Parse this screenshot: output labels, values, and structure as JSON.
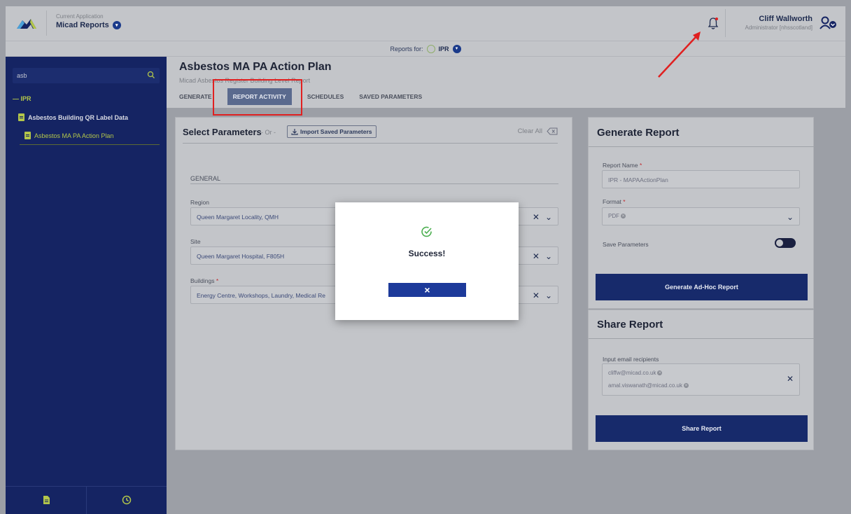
{
  "header": {
    "app_caption": "Current Application",
    "app_name": "Micad Reports",
    "user_name": "Cliff Wallworth",
    "user_role": "Administrator [nhsscotland]"
  },
  "reports_bar": {
    "label": "Reports for:",
    "value": "IPR"
  },
  "sidebar": {
    "search_value": "asb",
    "tree_root": "— IPR",
    "items": [
      {
        "label": "Asbestos Building QR Label Data"
      },
      {
        "label": "Asbestos MA PA Action Plan"
      }
    ]
  },
  "page": {
    "title": "Asbestos MA PA Action Plan",
    "subtitle": "Micad Asbestos Register Building Level Report",
    "tabs": [
      "GENERATE",
      "REPORT ACTIVITY",
      "SCHEDULES",
      "SAVED PARAMETERS"
    ]
  },
  "params": {
    "title": "Select Parameters",
    "or": "- Or -",
    "import_label": "Import Saved Parameters",
    "clear_all": "Clear All",
    "section": "GENERAL",
    "fields": [
      {
        "label": "Region",
        "value": "Queen Margaret Locality, QMH",
        "required": false
      },
      {
        "label": "Site",
        "value": "Queen Margaret Hospital, F805H",
        "required": false
      },
      {
        "label": "Buildings",
        "value": "Energy Centre, Workshops, Laundry, Medical Re",
        "required": true
      }
    ]
  },
  "generate": {
    "title": "Generate Report",
    "report_name_label": "Report Name",
    "report_name_value": "IPR - MAPAActionPlan",
    "format_label": "Format",
    "format_value": "PDF",
    "save_params_label": "Save Parameters",
    "button": "Generate Ad-Hoc Report"
  },
  "share": {
    "title": "Share Report",
    "email_label": "Input email recipients",
    "emails": [
      "cliffw@micad.co.uk",
      "amal.viswanath@micad.co.uk"
    ],
    "button": "Share Report"
  },
  "modal": {
    "message": "Success!",
    "close_icon": "×"
  },
  "colors": {
    "brand_navy": "#152463",
    "accent_lime": "#b3c64a",
    "button_blue": "#1d3a9a",
    "highlight_red": "#e02020"
  }
}
